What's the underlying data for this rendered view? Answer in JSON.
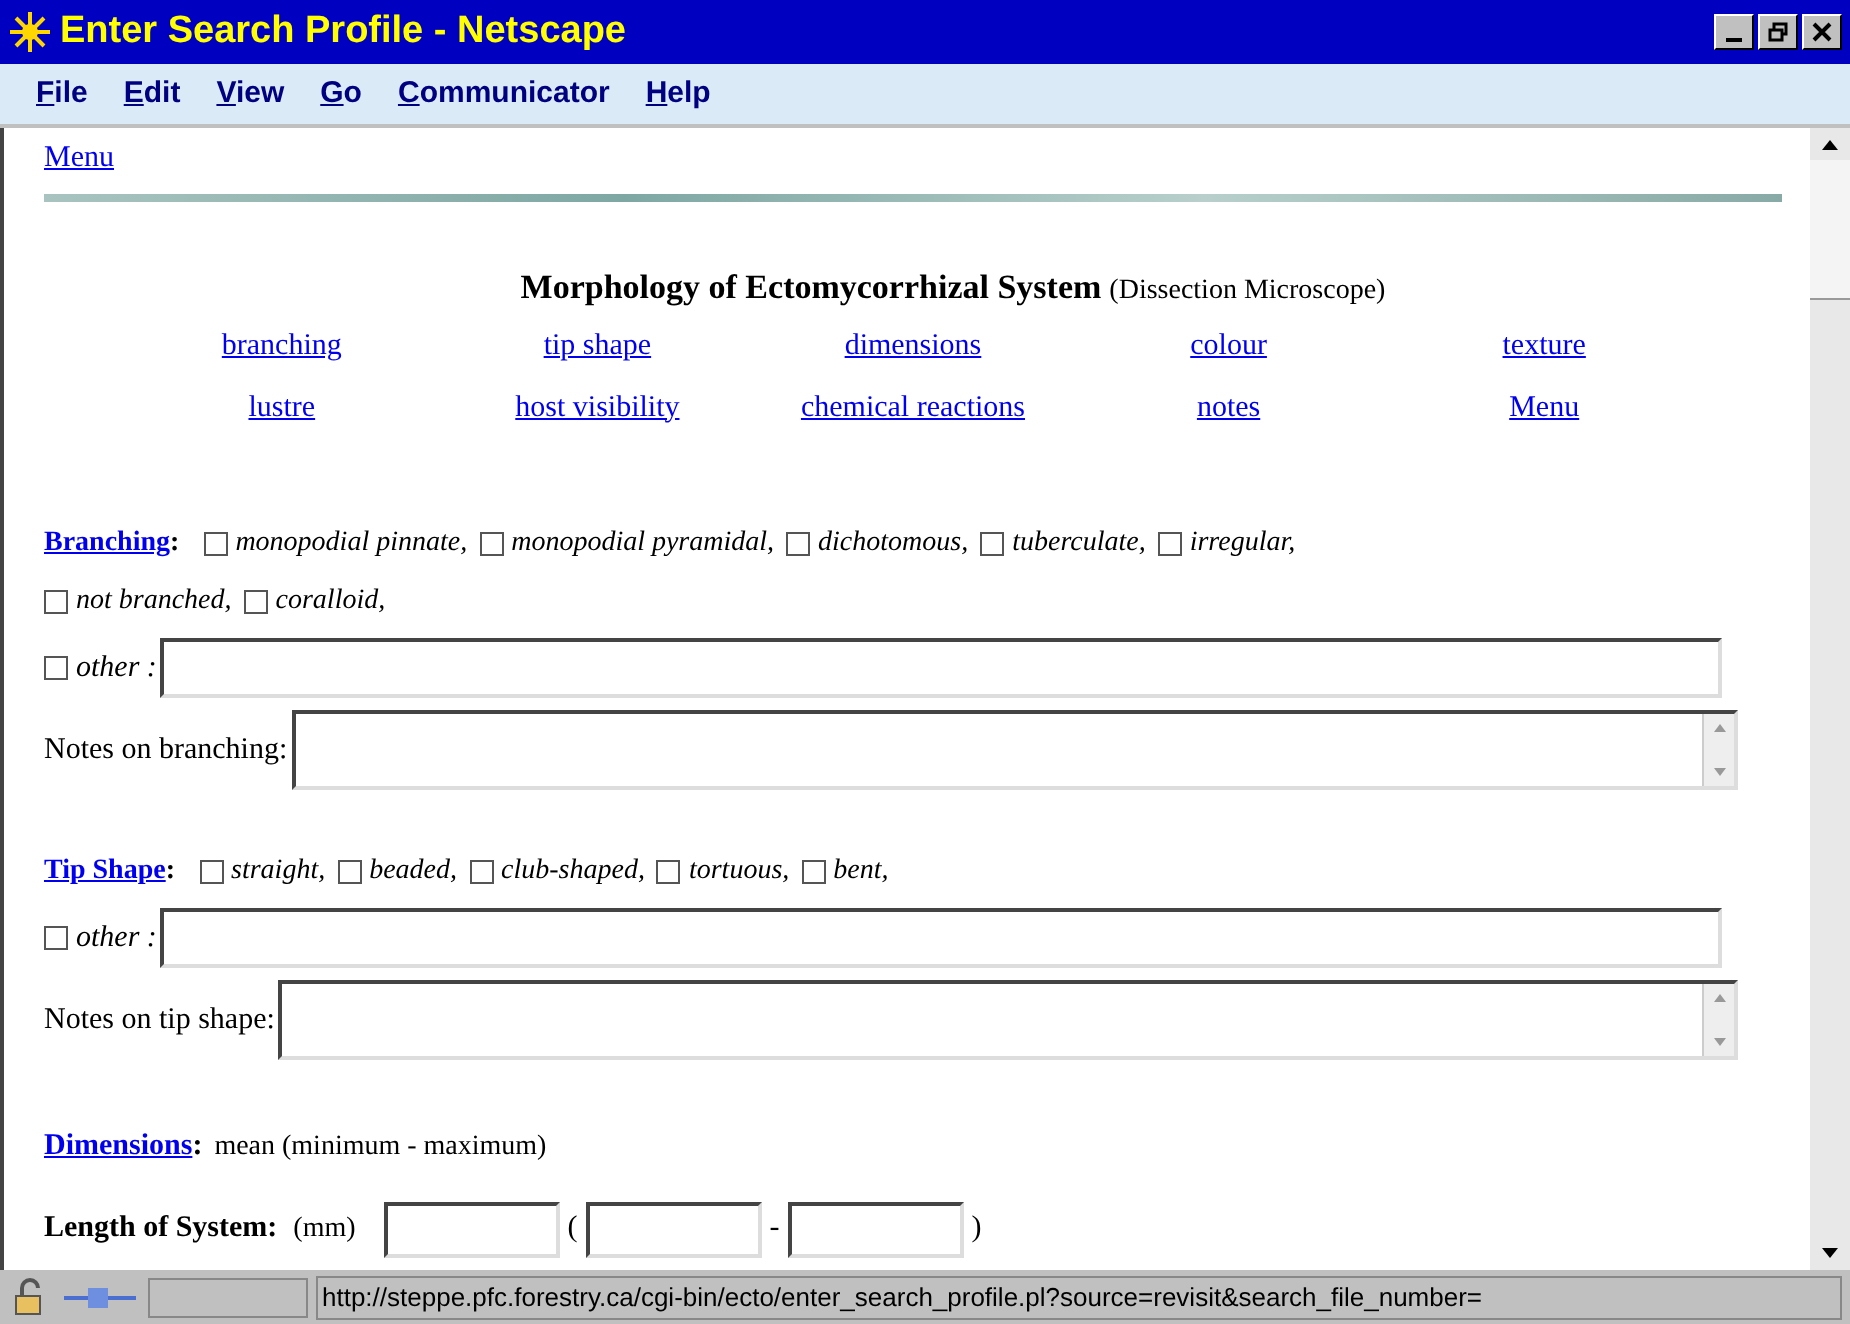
{
  "window": {
    "title": "Enter Search Profile - Netscape"
  },
  "menu_bar": [
    "File",
    "Edit",
    "View",
    "Go",
    "Communicator",
    "Help"
  ],
  "top_link": "Menu",
  "heading": {
    "title": "Morphology of Ectomycorrhizal System",
    "subtitle": "(Dissection Microscope)"
  },
  "nav_links": [
    [
      "branching",
      "tip shape",
      "dimensions",
      "colour",
      "texture"
    ],
    [
      "lustre",
      "host visibility",
      "chemical reactions",
      "notes",
      "Menu"
    ]
  ],
  "sections": [
    {
      "link": "Branching",
      "colon": ":",
      "options": [
        {
          "label": "monopodial pinnate,",
          "checked": false
        },
        {
          "label": "monopodial pyramidal,",
          "checked": false
        },
        {
          "label": "dichotomous,",
          "checked": false
        },
        {
          "label": "tuberculate,",
          "checked": false
        },
        {
          "label": "irregular,",
          "checked": false
        },
        {
          "label": "not branched,",
          "checked": false
        },
        {
          "label": "coralloid,",
          "checked": false
        }
      ],
      "other": {
        "label": "other :",
        "checked": false
      },
      "notes_label": "Notes on branching:"
    },
    {
      "link": "Tip Shape",
      "colon": ":",
      "options": [
        {
          "label": "straight,",
          "checked": false
        },
        {
          "label": "beaded,",
          "checked": false
        },
        {
          "label": "club-shaped,",
          "checked": false
        },
        {
          "label": "tortuous,",
          "checked": false
        },
        {
          "label": "bent,",
          "checked": false
        }
      ],
      "other": {
        "label": "other :",
        "checked": false
      },
      "notes_label": "Notes on tip shape:"
    }
  ],
  "dimensions": {
    "link": "Dimensions",
    "colon": ":",
    "text": "mean (minimum - maximum)"
  },
  "length_row": {
    "label": "Length of System:",
    "unit": "(mm)",
    "open": "(",
    "dash": "-",
    "close": ")"
  },
  "status_bar": {
    "url": "http://steppe.pfc.forestry.ca/cgi-bin/ecto/enter_search_profile.pl?source=revisit&search_file_number="
  }
}
